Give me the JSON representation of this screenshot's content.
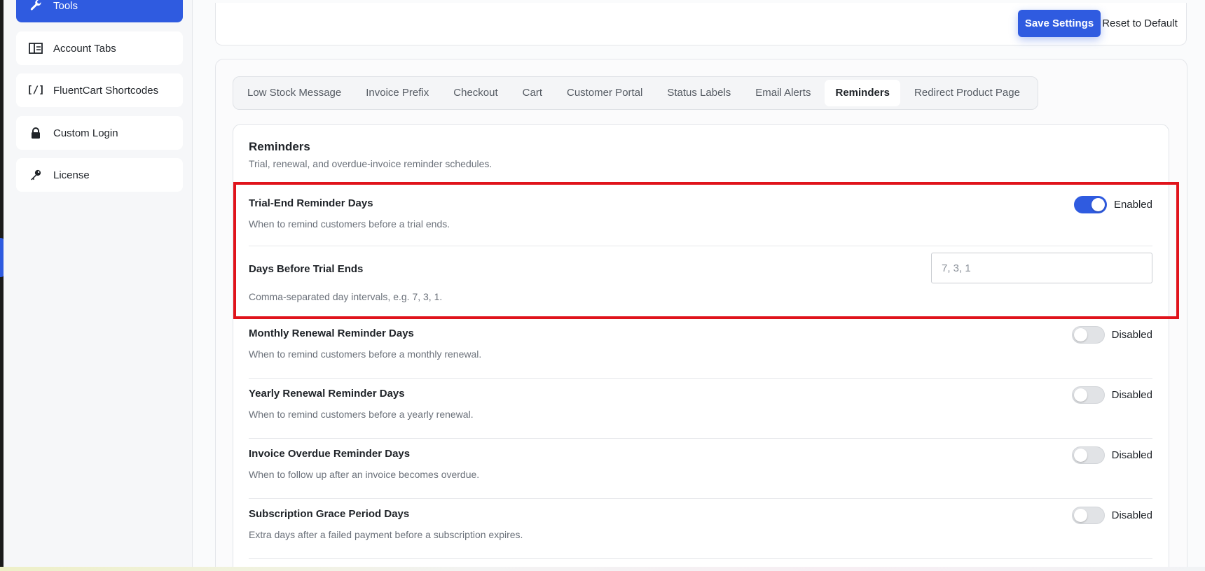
{
  "sidebar": {
    "items": [
      {
        "label": "Tools",
        "icon": "wrench-icon",
        "active": true
      },
      {
        "label": "Account Tabs",
        "icon": "layout-icon",
        "active": false
      },
      {
        "label": "FluentCart Shortcodes",
        "icon": "brackets-icon",
        "active": false
      },
      {
        "label": "Custom Login",
        "icon": "lock-icon",
        "active": false
      },
      {
        "label": "License",
        "icon": "key-icon",
        "active": false
      }
    ]
  },
  "toolbar": {
    "save_label": "Save Settings",
    "reset_label": "Reset to Default"
  },
  "tabs": [
    {
      "label": "Low Stock Message",
      "active": false
    },
    {
      "label": "Invoice Prefix",
      "active": false
    },
    {
      "label": "Checkout",
      "active": false
    },
    {
      "label": "Cart",
      "active": false
    },
    {
      "label": "Customer Portal",
      "active": false
    },
    {
      "label": "Status Labels",
      "active": false
    },
    {
      "label": "Email Alerts",
      "active": false
    },
    {
      "label": "Reminders",
      "active": true
    },
    {
      "label": "Redirect Product Page",
      "active": false
    }
  ],
  "section": {
    "title": "Reminders",
    "subtitle": "Trial, renewal, and overdue-invoice reminder schedules."
  },
  "settings": {
    "trial_end": {
      "label": "Trial-End Reminder Days",
      "description": "When to remind customers before a trial ends.",
      "state": "Enabled"
    },
    "days_before": {
      "label": "Days Before Trial Ends",
      "description": "Comma-separated day intervals, e.g. 7, 3, 1.",
      "placeholder": "7, 3, 1"
    },
    "monthly": {
      "label": "Monthly Renewal Reminder Days",
      "description": "When to remind customers before a monthly renewal.",
      "state": "Disabled"
    },
    "yearly": {
      "label": "Yearly Renewal Reminder Days",
      "description": "When to remind customers before a yearly renewal.",
      "state": "Disabled"
    },
    "overdue": {
      "label": "Invoice Overdue Reminder Days",
      "description": "When to follow up after an invoice becomes overdue.",
      "state": "Disabled"
    },
    "grace": {
      "label": "Subscription Grace Period Days",
      "description": "Extra days after a failed payment before a subscription expires.",
      "state": "Disabled"
    }
  },
  "colors": {
    "accent": "#2f5be0",
    "highlight": "#e0131b"
  }
}
